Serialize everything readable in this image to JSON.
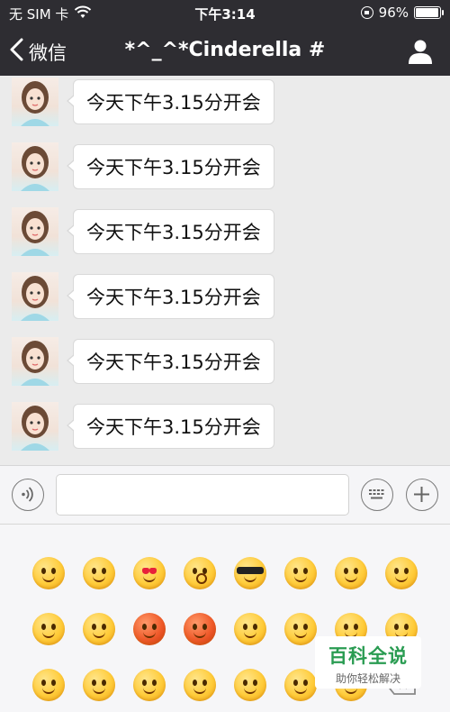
{
  "status_bar": {
    "carrier": "无 SIM 卡",
    "time": "下午3:14",
    "battery": "96%",
    "battery_level": 0.96,
    "icons": [
      "wifi-icon",
      "rotation-lock-icon",
      "battery-icon"
    ]
  },
  "nav": {
    "back_label": "微信",
    "title": "*^_^*Cinderella #",
    "profile_icon": "person-icon"
  },
  "messages": [
    {
      "text": "今天下午3.15分开会"
    },
    {
      "text": "今天下午3.15分开会"
    },
    {
      "text": "今天下午3.15分开会"
    },
    {
      "text": "今天下午3.15分开会"
    },
    {
      "text": "今天下午3.15分开会"
    },
    {
      "text": "今天下午3.15分开会"
    }
  ],
  "input_bar": {
    "value": "",
    "voice_icon": "voice-icon",
    "keyboard_icon": "keyboard-icon",
    "plus_icon": "plus-icon"
  },
  "emoji_rows": [
    [
      "smile",
      "shy",
      "heart-eyes",
      "surprised",
      "cool",
      "cry",
      "blush",
      "shush"
    ],
    [
      "sleepy",
      "sob",
      "red-embarrassed",
      "red-angry",
      "wink",
      "grin",
      "smile",
      "smile"
    ],
    [
      "stare",
      "scream",
      "dizzy",
      "giggle",
      "happy",
      "surprised",
      "smile",
      "backspace"
    ]
  ],
  "watermark": {
    "title": "百科全说",
    "subtitle": "助你轻松解决"
  },
  "colors": {
    "header_bg": "#2e2d32",
    "chat_bg": "#ebebeb",
    "bubble_bg": "#ffffff",
    "watermark_green": "#2a9c52"
  }
}
